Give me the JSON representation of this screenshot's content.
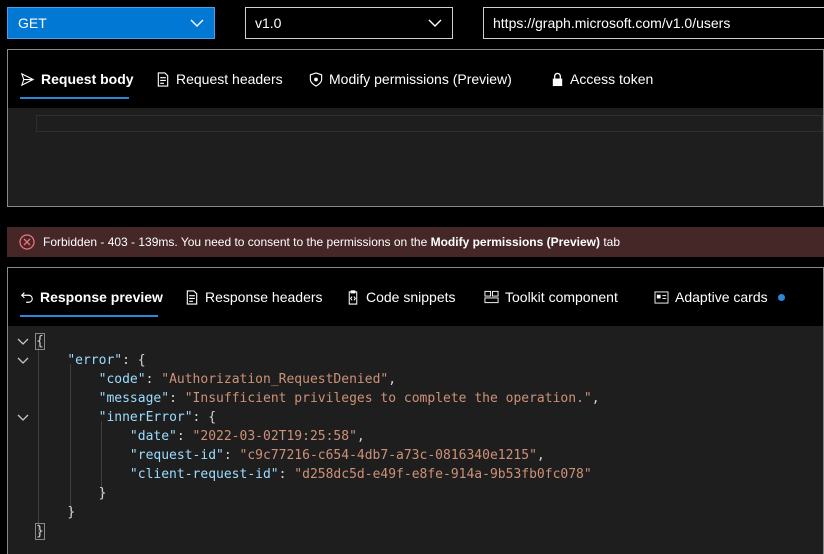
{
  "query": {
    "method": "GET",
    "version": "v1.0",
    "url": "https://graph.microsoft.com/v1.0/users"
  },
  "request": {
    "tabs": [
      {
        "label": "Request body",
        "icon": "send-icon",
        "active": true
      },
      {
        "label": "Request headers",
        "icon": "document-icon",
        "active": false
      },
      {
        "label": "Modify permissions (Preview)",
        "icon": "shield-key-icon",
        "active": false
      },
      {
        "label": "Access token",
        "icon": "lock-icon",
        "active": false
      }
    ]
  },
  "status": {
    "prefix": "Forbidden - 403 - 139ms. You need to consent to the permissions on the ",
    "bold": "Modify permissions (Preview)",
    "suffix": " tab",
    "color": "#442726",
    "icon": "error-circle-icon"
  },
  "response": {
    "tabs": [
      {
        "label": "Response preview",
        "icon": "undo-icon",
        "active": true
      },
      {
        "label": "Response headers",
        "icon": "document-icon",
        "active": false
      },
      {
        "label": "Code snippets",
        "icon": "clipboard-code-icon",
        "active": false
      },
      {
        "label": "Toolkit component",
        "icon": "component-icon",
        "active": false
      },
      {
        "label": "Adaptive cards",
        "icon": "card-icon",
        "active": false,
        "badge": true
      }
    ],
    "json_lines": [
      {
        "text": "{"
      },
      {
        "key": "\"error\"",
        "tail": ": {"
      },
      {
        "key": "\"code\"",
        "value": "\"Authorization_RequestDenied\"",
        "tail": ","
      },
      {
        "key": "\"message\"",
        "value": "\"Insufficient privileges to complete the operation.\"",
        "tail": ","
      },
      {
        "key": "\"innerError\"",
        "tail": ": {"
      },
      {
        "key": "\"date\"",
        "value": "\"2022-03-02T19:25:58\"",
        "tail": ","
      },
      {
        "key": "\"request-id\"",
        "value": "\"c9c77216-c654-4db7-a73c-0816340e1215\"",
        "tail": ","
      },
      {
        "key": "\"client-request-id\"",
        "value": "\"d258dc5d-e49f-e8fe-914a-9b53fb0fc078\"",
        "tail": ""
      },
      {
        "text": "}"
      },
      {
        "text": "}"
      },
      {
        "text": "}"
      }
    ]
  },
  "colors": {
    "accent": "#0078d4",
    "tab_underline": "#2b88d8",
    "json_key": "#9cdcfe",
    "json_string": "#ce9178"
  }
}
